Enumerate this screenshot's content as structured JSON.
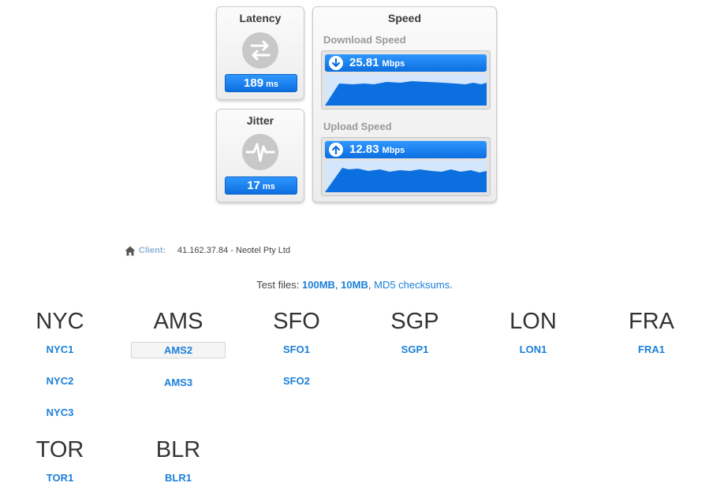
{
  "latency": {
    "title": "Latency",
    "value": "189",
    "unit": "ms"
  },
  "jitter": {
    "title": "Jitter",
    "value": "17",
    "unit": "ms"
  },
  "speed": {
    "title": "Speed",
    "download": {
      "label": "Download Speed",
      "value": "25.81",
      "unit": "Mbps"
    },
    "upload": {
      "label": "Upload Speed",
      "value": "12.83",
      "unit": "Mbps"
    }
  },
  "client": {
    "label": "Client:",
    "value": "41.162.37.84 - Neotel Pty Ltd"
  },
  "test_files": {
    "prefix": "Test files:",
    "link_100mb": "100MB",
    "comma1": ",",
    "link_10mb": "10MB",
    "comma2": ",",
    "link_md5": "MD5 checksums",
    "suffix": "."
  },
  "datacenters": {
    "nyc": {
      "code": "NYC",
      "links": [
        "NYC1",
        "NYC2",
        "NYC3"
      ]
    },
    "ams": {
      "code": "AMS",
      "links": [
        "AMS2",
        "AMS3"
      ]
    },
    "sfo": {
      "code": "SFO",
      "links": [
        "SFO1",
        "SFO2"
      ]
    },
    "sgp": {
      "code": "SGP",
      "links": [
        "SGP1"
      ]
    },
    "lon": {
      "code": "LON",
      "links": [
        "LON1"
      ]
    },
    "fra": {
      "code": "FRA",
      "links": [
        "FRA1"
      ]
    },
    "tor": {
      "code": "TOR",
      "links": [
        "TOR1"
      ]
    },
    "blr": {
      "code": "BLR",
      "links": [
        "BLR1"
      ]
    }
  },
  "colors": {
    "accent_blue": "#1a7fd9",
    "pill_blue": "#2f97ff",
    "graph_fill": "#0c6fe0"
  },
  "icons": {
    "latency": "arrows-exchange-icon",
    "jitter": "pulse-icon",
    "download": "arrow-down-circle-icon",
    "upload": "arrow-up-circle-icon",
    "client": "home-icon"
  }
}
